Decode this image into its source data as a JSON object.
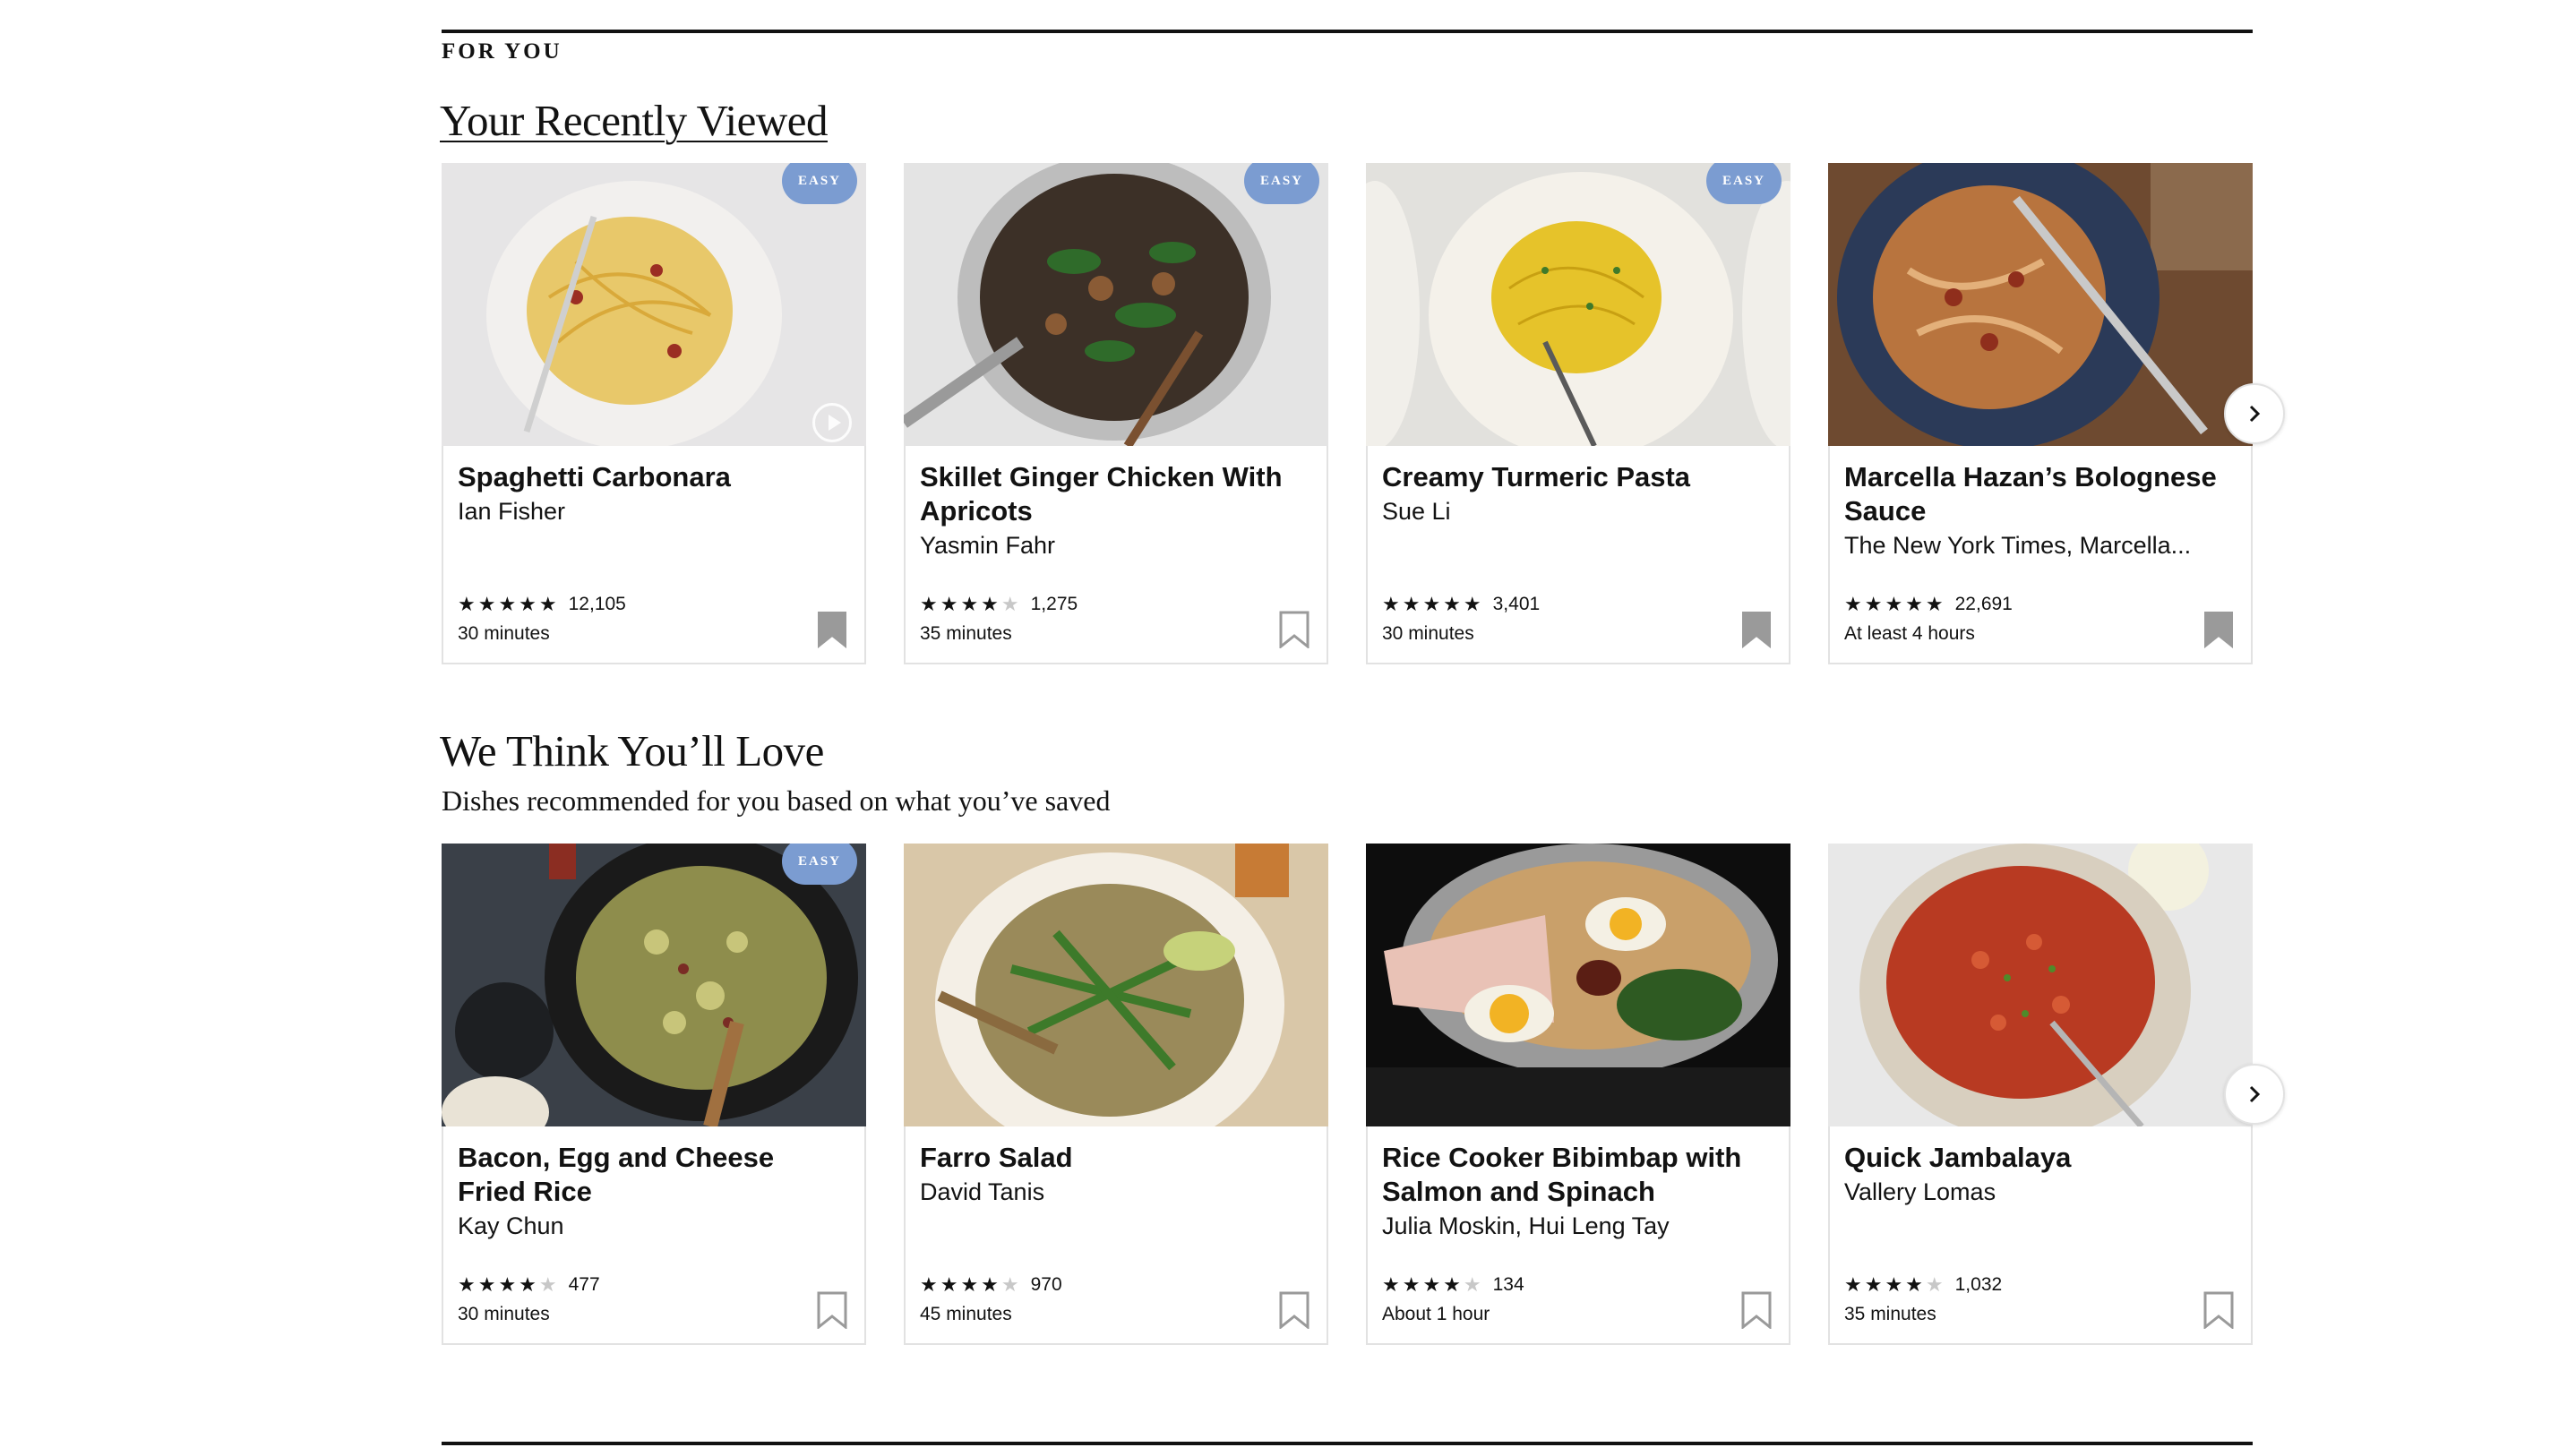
{
  "kicker": "FOR YOU",
  "recent": {
    "title": "Your Recently Viewed",
    "cards": [
      {
        "title": "Spaghetti Carbonara",
        "author": "Ian Fisher",
        "stars": 5,
        "count": "12,105",
        "time": "30 minutes",
        "badge": "EASY"
      },
      {
        "title": "Skillet Ginger Chicken With Apricots",
        "author": "Yasmin Fahr",
        "stars": 4,
        "count": "1,275",
        "time": "35 minutes",
        "badge": "EASY"
      },
      {
        "title": "Creamy Turmeric Pasta",
        "author": "Sue Li",
        "stars": 5,
        "count": "3,401",
        "time": "30 minutes",
        "badge": "EASY"
      },
      {
        "title": "Marcella Hazan’s Bolognese Sauce",
        "author": "The New York Times, Marcella...",
        "stars": 5,
        "count": "22,691",
        "time": "At least 4 hours"
      }
    ]
  },
  "love": {
    "title": "We Think You’ll Love",
    "subtitle": "Dishes recommended for you based on what you’ve saved",
    "cards": [
      {
        "title": "Bacon, Egg and Cheese Fried Rice",
        "author": "Kay Chun",
        "stars": 4,
        "count": "477",
        "time": "30 minutes",
        "badge": "EASY"
      },
      {
        "title": "Farro Salad",
        "author": "David Tanis",
        "stars": 4,
        "count": "970",
        "time": "45 minutes"
      },
      {
        "title": "Rice Cooker Bibimbap with Salmon and Spinach",
        "author": "Julia Moskin, Hui Leng Tay",
        "stars": 4,
        "count": "134",
        "time": "About 1 hour"
      },
      {
        "title": "Quick Jambalaya",
        "author": "Vallery Lomas",
        "stars": 4,
        "count": "1,032",
        "time": "35 minutes"
      }
    ]
  },
  "colors": {
    "badge": "#7b9cd1",
    "text": "#121212",
    "border": "#e2e2e2"
  },
  "icons": {
    "bookmark": "bookmark-icon",
    "next": "chevron-right-icon",
    "play": "play-icon"
  }
}
